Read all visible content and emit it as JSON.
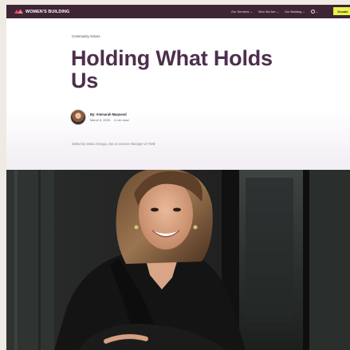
{
  "brand": {
    "logo_text": "WOMEN'S BUILDING",
    "colors": {
      "nav_bg": "#3d2536",
      "donate_bg": "#e7f44a",
      "title": "#4d2f4d"
    }
  },
  "nav": {
    "links": [
      "Our Services ⌄",
      "Who We Are ⌄",
      "Our Building ⌄"
    ],
    "language_caret": "⌄",
    "donate_label": "Donate"
  },
  "article": {
    "category": "Community Voices",
    "title": "Holding What Holds Us",
    "author": "By: Ammarah Maqsood",
    "date": "March 5, 2026",
    "separator": "·",
    "read_time": "4 min read",
    "editor_note": "Edited by Maria Arteaga, Dev & Comms Manager at TWB"
  },
  "icons": {
    "logo": "wb-logo-icon",
    "language": "globe-icon"
  }
}
